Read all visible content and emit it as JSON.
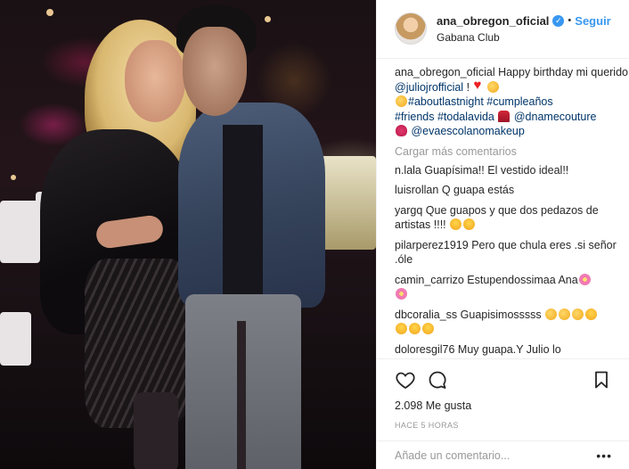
{
  "header": {
    "username": "ana_obregon_oficial",
    "verified_icon": "✓",
    "separator": "•",
    "follow_label": "Seguir",
    "location": "Gabana Club"
  },
  "caption": {
    "username": "ana_obregon_oficial",
    "text1": "Happy birthday mi querido",
    "mention1": "@juliojrofficial",
    "text2": "!",
    "tags1": "#aboutlastnight #cumpleaños",
    "tags2": "#friends #todalavida",
    "mention2": "@dnamecouture",
    "mention3": "@evaescolanomakeup"
  },
  "more_comments_label": "Cargar más comentarios",
  "comments": [
    {
      "user": "n.lala",
      "text": "Guapísima!! El vestido ideal!!"
    },
    {
      "user": "luisrollan",
      "text": "Q guapa estás"
    },
    {
      "user": "yargq",
      "text": "Que guapos y que dos pedazos de artistas !!!!"
    },
    {
      "user": "pilarperez1919",
      "text": "Pero que chula eres .si señor .óle"
    },
    {
      "user": "camin_carrizo",
      "text": "Estupendossimaa Ana"
    },
    {
      "user": "dbcoralia_ss",
      "text": "Guapisimosssss"
    },
    {
      "user": "doloresgil76",
      "text": "Muy guapa.Y Julio lo"
    }
  ],
  "icons": {
    "like": "heart-outline-icon",
    "comment": "speech-bubble-icon",
    "save": "bookmark-icon",
    "more": "ellipsis-icon"
  },
  "likes_label": "2.098 Me gusta",
  "time_label": "HACE 5 HORAS",
  "add_comment": {
    "placeholder": "Añade un comentario...",
    "more_label": "•••"
  }
}
